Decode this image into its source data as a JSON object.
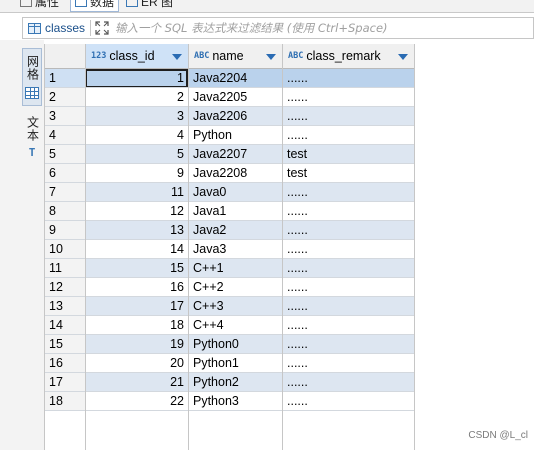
{
  "tabs": [
    {
      "label": "属性",
      "icon": "properties-icon"
    },
    {
      "label": "数据",
      "icon": "data-icon",
      "active": true
    },
    {
      "label": "ER 图",
      "icon": "er-diagram-icon"
    }
  ],
  "filter": {
    "table_name": "classes",
    "placeholder": "输入一个 SQL 表达式来过滤结果 (使用 Ctrl+Space)",
    "value": ""
  },
  "side_tabs": [
    {
      "label": "网格",
      "icon": "grid-icon",
      "active": true
    },
    {
      "label": "文本",
      "icon": "text-icon",
      "active": false
    }
  ],
  "columns": [
    {
      "name": "class_id",
      "type_icon": "123",
      "selected": true
    },
    {
      "name": "name",
      "type_icon": "ABC",
      "selected": false
    },
    {
      "name": "class_remark",
      "type_icon": "ABC",
      "selected": false
    }
  ],
  "rows": [
    {
      "n": "1",
      "class_id": "1",
      "name": "Java2204",
      "class_remark": "......"
    },
    {
      "n": "2",
      "class_id": "2",
      "name": "Java2205",
      "class_remark": "......"
    },
    {
      "n": "3",
      "class_id": "3",
      "name": "Java2206",
      "class_remark": "......"
    },
    {
      "n": "4",
      "class_id": "4",
      "name": "Python",
      "class_remark": "......"
    },
    {
      "n": "5",
      "class_id": "5",
      "name": "Java2207",
      "class_remark": "test"
    },
    {
      "n": "6",
      "class_id": "9",
      "name": "Java2208",
      "class_remark": "test"
    },
    {
      "n": "7",
      "class_id": "11",
      "name": "Java0",
      "class_remark": "......"
    },
    {
      "n": "8",
      "class_id": "12",
      "name": "Java1",
      "class_remark": "......"
    },
    {
      "n": "9",
      "class_id": "13",
      "name": "Java2",
      "class_remark": "......"
    },
    {
      "n": "10",
      "class_id": "14",
      "name": "Java3",
      "class_remark": "......"
    },
    {
      "n": "11",
      "class_id": "15",
      "name": "C++1",
      "class_remark": "......"
    },
    {
      "n": "12",
      "class_id": "16",
      "name": "C++2",
      "class_remark": "......"
    },
    {
      "n": "13",
      "class_id": "17",
      "name": "C++3",
      "class_remark": "......"
    },
    {
      "n": "14",
      "class_id": "18",
      "name": "C++4",
      "class_remark": "......"
    },
    {
      "n": "15",
      "class_id": "19",
      "name": "Python0",
      "class_remark": "......"
    },
    {
      "n": "16",
      "class_id": "20",
      "name": "Python1",
      "class_remark": "......"
    },
    {
      "n": "17",
      "class_id": "21",
      "name": "Python2",
      "class_remark": "......"
    },
    {
      "n": "18",
      "class_id": "22",
      "name": "Python3",
      "class_remark": "......"
    }
  ],
  "selected_row": "1",
  "watermark": "CSDN @L_cl"
}
